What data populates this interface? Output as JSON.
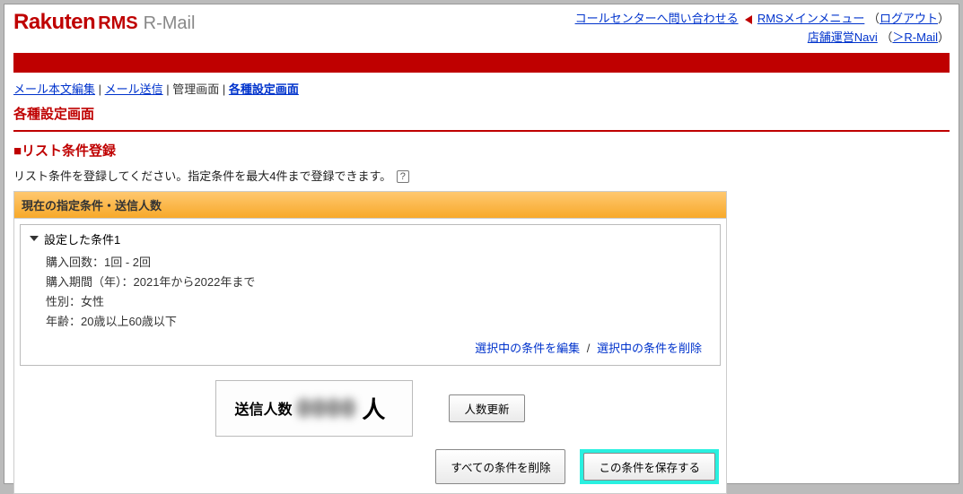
{
  "header": {
    "logo_main": "Rakuten",
    "logo_rms": "RMS",
    "logo_sub": "R-Mail",
    "link_call_center": "コールセンターへ問い合わせる",
    "link_main_menu": "RMSメインメニュー",
    "link_logout": "ログアウト",
    "link_shop_navi": "店舗運営Navi",
    "link_rmail": "＞R-Mail"
  },
  "breadcrumbs": {
    "item1": "メール本文編集",
    "item2": "メール送信",
    "item3": "管理画面",
    "item4": "各種設定画面"
  },
  "screen_title": "各種設定画面",
  "section_title": "■リスト条件登録",
  "instruction": "リスト条件を登録してください。指定条件を最大4件まで登録できます。",
  "panel": {
    "header": "現在の指定条件・送信人数",
    "cond_title": "設定した条件1",
    "rows": {
      "r1": "購入回数：1回 - 2回",
      "r2": "購入期間（年）：2021年から2022年まで",
      "r3": "性別：女性",
      "r4": "年齢：20歳以上60歳以下"
    },
    "edit": "選択中の条件を編集",
    "delete": "選択中の条件を削除"
  },
  "count": {
    "label": "送信人数",
    "value": "0000",
    "unit": "人",
    "update_btn": "人数更新"
  },
  "buttons": {
    "delete_all": "すべての条件を削除",
    "save": "この条件を保存する"
  }
}
